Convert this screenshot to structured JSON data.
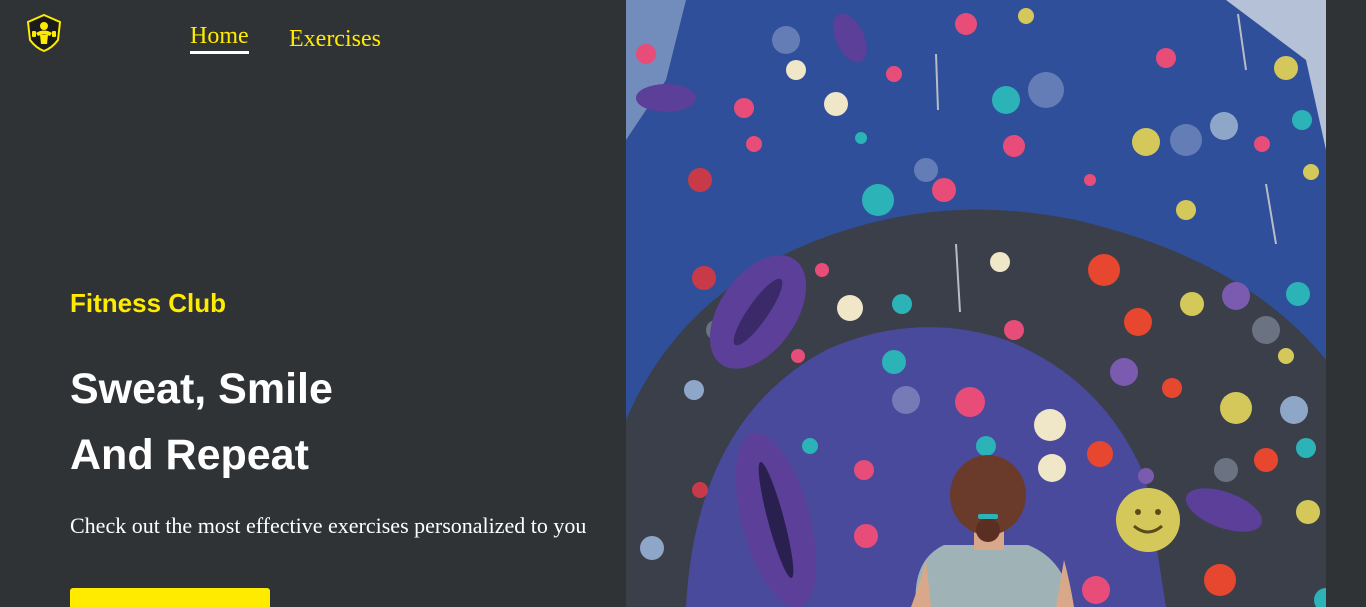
{
  "nav": {
    "links": [
      {
        "label": "Home",
        "active": true
      },
      {
        "label": "Exercises",
        "active": false
      }
    ]
  },
  "hero": {
    "eyebrow": "Fitness Club",
    "headline_line1": "Sweat, Smile",
    "headline_line2": "And Repeat",
    "subtext": "Check out the most effective exercises personalized to you",
    "image_icon": "climbing-wall-photo"
  },
  "colors": {
    "background": "#303335",
    "accent": "#ffeb00",
    "text": "#ffffff"
  }
}
